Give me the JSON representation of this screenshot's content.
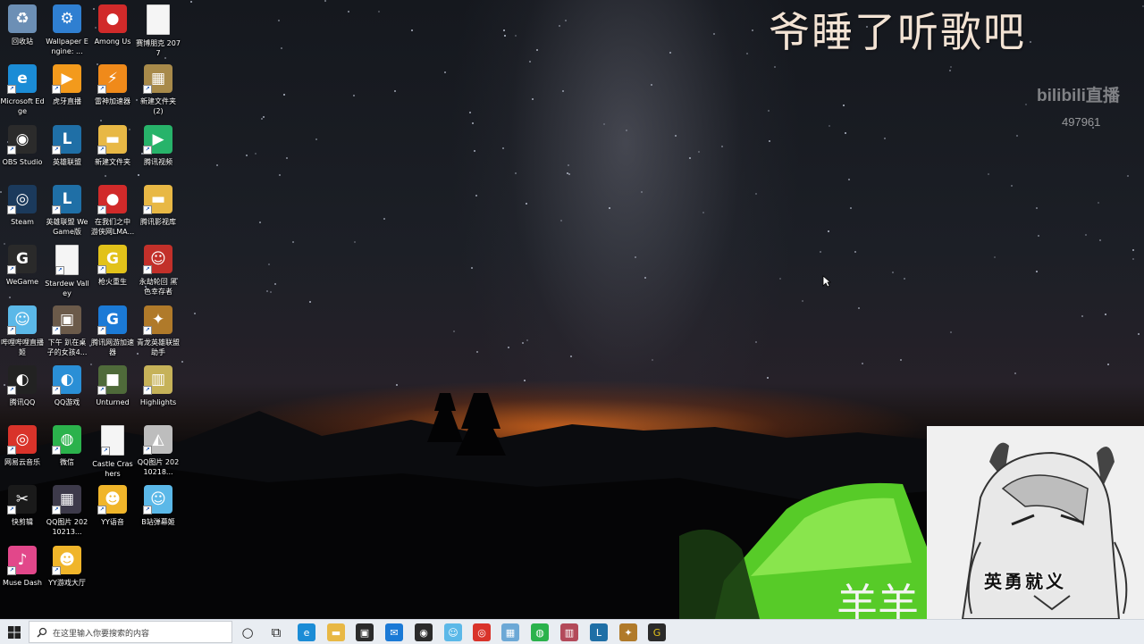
{
  "overlay": {
    "title": "爷睡了听歌吧",
    "bili_logo": "bilibili直播",
    "viewer_count": "497961",
    "streamer_name": "羊羊",
    "avatar_caption": "英勇就义"
  },
  "desktop_icons": [
    {
      "label": "回收站",
      "name": "recycle-bin-icon",
      "glyph": "♻",
      "color": "#6c8fb5"
    },
    {
      "label": "Wallpaper Engine: ...",
      "name": "wallpaper-engine-icon",
      "glyph": "⚙",
      "color": "#2f7fd1"
    },
    {
      "label": "Among Us",
      "name": "among-us-icon",
      "glyph": "●",
      "color": "#d12a2a"
    },
    {
      "label": "赛博朋克 2077",
      "name": "cyberpunk-file-icon",
      "glyph": "",
      "color": "#f5f5f5"
    },
    {
      "label": "Microsoft Edge",
      "name": "edge-icon",
      "glyph": "e",
      "color": "#1b8cd6"
    },
    {
      "label": "虎牙直播",
      "name": "huya-icon",
      "glyph": "▶",
      "color": "#f39a1c"
    },
    {
      "label": "雷神加速器",
      "name": "leishen-icon",
      "glyph": "⚡",
      "color": "#f08a1a"
    },
    {
      "label": "新建文件夹 (2)",
      "name": "folder-icon",
      "glyph": "▦",
      "color": "#a88a4a"
    },
    {
      "label": "OBS Studio",
      "name": "obs-icon",
      "glyph": "◉",
      "color": "#2b2b2b"
    },
    {
      "label": "英雄联盟",
      "name": "lol-icon",
      "glyph": "L",
      "color": "#1f6fa6"
    },
    {
      "label": "新建文件夹",
      "name": "folder-icon",
      "glyph": "▬",
      "color": "#e8b845"
    },
    {
      "label": "腾讯视频",
      "name": "tencent-video-icon",
      "glyph": "▶",
      "color": "#27b36a"
    },
    {
      "label": "Steam",
      "name": "steam-icon",
      "glyph": "◎",
      "color": "#1b3a5c"
    },
    {
      "label": "英雄联盟 WeGame版",
      "name": "lol-wegame-icon",
      "glyph": "L",
      "color": "#1f6fa6"
    },
    {
      "label": "在我们之中 游侠网LMA...",
      "name": "among-us-icon",
      "glyph": "●",
      "color": "#d12a2a"
    },
    {
      "label": "腾讯影视库",
      "name": "folder-icon",
      "glyph": "▬",
      "color": "#e8b845"
    },
    {
      "label": "WeGame",
      "name": "wegame-icon",
      "glyph": "G",
      "color": "#2a2a2a"
    },
    {
      "label": "Stardew Valley",
      "name": "stardew-file-icon",
      "glyph": "",
      "color": "#f5f5f5"
    },
    {
      "label": "枪火重生",
      "name": "gunfire-icon",
      "glyph": "G",
      "color": "#e2c21a"
    },
    {
      "label": "永劫轮回 黑色幸存者",
      "name": "game-icon",
      "glyph": "☺",
      "color": "#c2302a"
    },
    {
      "label": "哔哩哔哩直播姬",
      "name": "bilibili-live-icon",
      "glyph": "☺",
      "color": "#5bb8e8"
    },
    {
      "label": "下午 趴在桌子的女孩4...",
      "name": "image-icon",
      "glyph": "▣",
      "color": "#6b5a4a"
    },
    {
      "label": "腾讯网游加速器",
      "name": "tencent-accel-icon",
      "glyph": "G",
      "color": "#1b7ad6"
    },
    {
      "label": "青龙英雄联盟助手",
      "name": "lol-helper-icon",
      "glyph": "✦",
      "color": "#b07a2a"
    },
    {
      "label": "腾讯QQ",
      "name": "qq-icon",
      "glyph": "◐",
      "color": "#222"
    },
    {
      "label": "QQ游戏",
      "name": "qq-game-icon",
      "glyph": "◐",
      "color": "#2a8fd6"
    },
    {
      "label": "Unturned",
      "name": "unturned-icon",
      "glyph": "■",
      "color": "#4f6a3a"
    },
    {
      "label": "Highlights",
      "name": "highlights-icon",
      "glyph": "▥",
      "color": "#c6b259"
    },
    {
      "label": "网易云音乐",
      "name": "netease-music-icon",
      "glyph": "◎",
      "color": "#d9332a"
    },
    {
      "label": "微信",
      "name": "wechat-icon",
      "glyph": "◍",
      "color": "#2bb24c"
    },
    {
      "label": "Castle Crashers",
      "name": "castle-file-icon",
      "glyph": "",
      "color": "#f5f5f5"
    },
    {
      "label": "QQ图片 20210218...",
      "name": "image-icon",
      "glyph": "◭",
      "color": "#bdbdbd"
    },
    {
      "label": "快剪辑",
      "name": "kuaijianji-icon",
      "glyph": "✂",
      "color": "#1a1a1a"
    },
    {
      "label": "QQ图片 20210213...",
      "name": "image-icon",
      "glyph": "▦",
      "color": "#3d3a4a"
    },
    {
      "label": "YY语音",
      "name": "yy-icon",
      "glyph": "☻",
      "color": "#f0b52a"
    },
    {
      "label": "B站弹幕姬",
      "name": "bilibili-danmaku-icon",
      "glyph": "☺",
      "color": "#5bb8e8"
    },
    {
      "label": "Muse Dash",
      "name": "muse-dash-icon",
      "glyph": "♪",
      "color": "#e2478a"
    },
    {
      "label": "YY游戏大厅",
      "name": "yy-game-icon",
      "glyph": "☻",
      "color": "#f0b52a"
    }
  ],
  "taskbar": {
    "search_placeholder": "在这里输入你要搜索的内容",
    "apps": [
      {
        "name": "cortana-icon",
        "glyph": "○",
        "color": "transparent",
        "fg": "#222"
      },
      {
        "name": "task-view-icon",
        "glyph": "⧉",
        "color": "transparent",
        "fg": "#222"
      },
      {
        "name": "edge-taskbar-icon",
        "glyph": "e",
        "color": "#1b8cd6",
        "fg": "#fff"
      },
      {
        "name": "file-explorer-icon",
        "glyph": "▬",
        "color": "#e8b845",
        "fg": "#fff"
      },
      {
        "name": "store-icon",
        "glyph": "▣",
        "color": "#2b2b2b",
        "fg": "#fff"
      },
      {
        "name": "mail-icon",
        "glyph": "✉",
        "color": "#1b7ad6",
        "fg": "#fff"
      },
      {
        "name": "obs-taskbar-icon",
        "glyph": "◉",
        "color": "#2b2b2b",
        "fg": "#fff"
      },
      {
        "name": "bilibili-live-taskbar-icon",
        "glyph": "☺",
        "color": "#5bb8e8",
        "fg": "#fff"
      },
      {
        "name": "netease-taskbar-icon",
        "glyph": "◎",
        "color": "#d9332a",
        "fg": "#fff"
      },
      {
        "name": "app-taskbar-icon",
        "glyph": "▦",
        "color": "#6ca8d6",
        "fg": "#fff"
      },
      {
        "name": "wechat-taskbar-icon",
        "glyph": "◍",
        "color": "#2bb24c",
        "fg": "#fff"
      },
      {
        "name": "app2-taskbar-icon",
        "glyph": "▥",
        "color": "#b34a5a",
        "fg": "#fff"
      },
      {
        "name": "lol-taskbar-icon",
        "glyph": "L",
        "color": "#1f6fa6",
        "fg": "#fff"
      },
      {
        "name": "lol-helper-taskbar-icon",
        "glyph": "✦",
        "color": "#b07a2a",
        "fg": "#fff"
      },
      {
        "name": "gunfire-taskbar-icon",
        "glyph": "G",
        "color": "#2a2a2a",
        "fg": "#e2c21a"
      }
    ]
  },
  "colors": {
    "taskbar_bg": "#e9edf2",
    "tent_green": "#5cd62a",
    "sunset_orange": "#e66e1e"
  }
}
